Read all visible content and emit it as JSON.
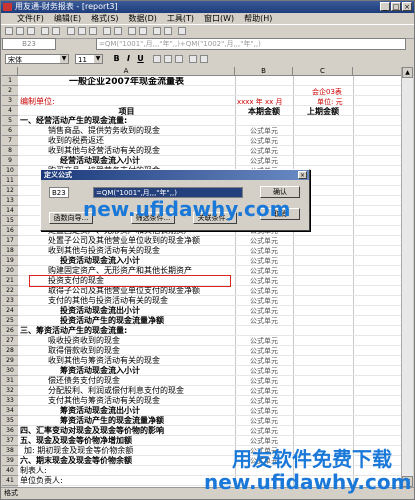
{
  "window": {
    "title": "用友通-财务报表 - [report3]"
  },
  "menu": [
    "文件(F)",
    "编辑(E)",
    "格式(S)",
    "数据(D)",
    "工具(T)",
    "窗口(W)",
    "帮助(H)"
  ],
  "formula_bar": {
    "cell": "B23",
    "formula": "=QM(\"1001\",月,,,\"年\",,)+QM(\"1002\",月,,,\"年\",,)"
  },
  "format_bar": {
    "font": "宋体",
    "size": "11",
    "bold": "B",
    "italic": "I",
    "underline": "U"
  },
  "sheet": {
    "columns": [
      "A",
      "B",
      "C"
    ],
    "report_title": "一般企业2007年现金流量表",
    "form_code": "会企03表",
    "unit_label": "编制单位:",
    "date_label": "xxxx 年 xx 月",
    "money_unit": "单位: 元",
    "header_item": "项目",
    "header_current": "本期金额",
    "header_prior": "上期金额",
    "formula_cell": "公式单元",
    "row_numbers": [
      "1",
      "2",
      "3",
      "4",
      "5",
      "6",
      "7",
      "8",
      "9",
      "10",
      "11",
      "12",
      "13",
      "14",
      "15",
      "16",
      "17",
      "18",
      "19",
      "20",
      "21",
      "22",
      "23",
      "24",
      "25",
      "26",
      "27",
      "28",
      "29",
      "30",
      "31",
      "32",
      "33",
      "34",
      "35",
      "36",
      "37",
      "38",
      "39",
      "40",
      "41",
      "42"
    ],
    "rows": [
      {
        "label": "一、经营活动产生的现金流量:",
        "b": ""
      },
      {
        "label": "销售商品、提供劳务收到的现金",
        "b": "公式单元"
      },
      {
        "label": "收到的税费返还",
        "b": "公式单元"
      },
      {
        "label": "收到其他与经营活动有关的现金",
        "b": "公式单元"
      },
      {
        "label": "经营活动现金流入小计",
        "b": "公式单元"
      },
      {
        "label": "购买商品、接受劳务支付的现金",
        "b": "公式单元"
      },
      {
        "label": "",
        "b": "公式单元"
      },
      {
        "label": "",
        "b": "公式单元"
      },
      {
        "label": "",
        "b": "公式单元"
      },
      {
        "label": "",
        "b": "公式单元"
      },
      {
        "label": "",
        "b": "公式单元"
      },
      {
        "label": "处置固定资产、无形资产和其他长期资产",
        "b": "公式单元"
      },
      {
        "label": "处置子公司及其他营业单位收到的现金净额",
        "b": "公式单元"
      },
      {
        "label": "收到其他与投资活动有关的现金",
        "b": "公式单元"
      },
      {
        "label": "投资活动现金流入小计",
        "b": "公式单元"
      },
      {
        "label": "购建固定资产、无形资产和其他长期资产",
        "b": "公式单元"
      },
      {
        "label": "投资支付的现金",
        "b": "公式单元"
      },
      {
        "label": "取得子公司及其他营业单位支付的现金净额",
        "b": "公式单元"
      },
      {
        "label": "支付的其他与投资活动有关的现金",
        "b": "公式单元"
      },
      {
        "label": "投资活动现金流出小计",
        "b": "公式单元"
      },
      {
        "label": "投资活动产生的现金流量净额",
        "b": "公式单元"
      },
      {
        "label": "三、筹资活动产生的现金流量:",
        "b": ""
      },
      {
        "label": "吸收投资收到的现金",
        "b": "公式单元"
      },
      {
        "label": "取得借款收到的现金",
        "b": "公式单元"
      },
      {
        "label": "收到其他与筹资活动有关的现金",
        "b": "公式单元"
      },
      {
        "label": "筹资活动现金流入小计",
        "b": "公式单元"
      },
      {
        "label": "偿还债务支付的现金",
        "b": "公式单元"
      },
      {
        "label": "分配股利、利润或偿付利息支付的现金",
        "b": "公式单元"
      },
      {
        "label": "支付其他与筹资活动有关的现金",
        "b": "公式单元"
      },
      {
        "label": "筹资活动现金流出小计",
        "b": "公式单元"
      },
      {
        "label": "筹资活动产生的现金流量净额",
        "b": "公式单元"
      },
      {
        "label": "四、汇率变动对现金及现金等价物的影响",
        "b": "公式单元"
      },
      {
        "label": "五、现金及现金等价物净增加额",
        "b": "公式单元"
      },
      {
        "label": "加: 期初现金及现金等价物余额",
        "b": "公式单元"
      },
      {
        "label": "六、期末现金及现金等价物余额",
        "b": "公式单元"
      },
      {
        "label": "制表人:",
        "b": ""
      },
      {
        "label": "单位负责人:",
        "b": ""
      }
    ]
  },
  "dialog": {
    "title": "定义公式",
    "cell": "B23",
    "formula": "=QM(\"1001\",月,,,\"年\",,)",
    "func_button": "函数向导...",
    "filter_button": "筛选条件...",
    "relation_button": "关联条件...",
    "ok": "确认",
    "cancel": "取消"
  },
  "statusbar": {
    "text": "格式"
  },
  "watermarks": {
    "top": "new.ufidawhy.com",
    "bottom_cn": "用友软件免费下载",
    "bottom_url": "new.ufidawhy.com"
  }
}
